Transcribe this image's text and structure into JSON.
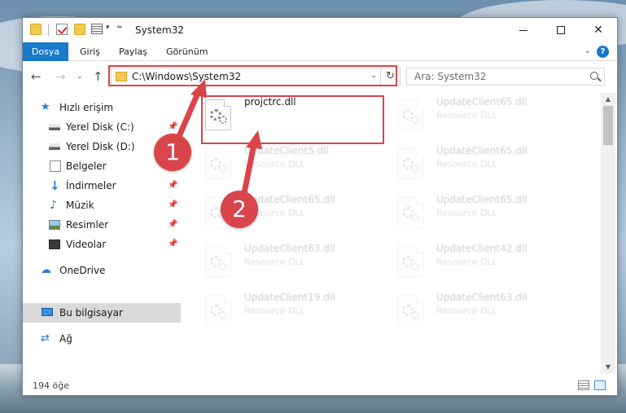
{
  "window": {
    "title": "System32",
    "minimize_icon": "minimize-icon",
    "maximize_icon": "maximize-icon",
    "close_label": "✕"
  },
  "ribbon": {
    "tabs": [
      {
        "label": "Dosya"
      },
      {
        "label": "Giriş"
      },
      {
        "label": "Paylaş"
      },
      {
        "label": "Görünüm"
      }
    ],
    "help_label": "?"
  },
  "navigation": {
    "address_path": "C:\\Windows\\System32",
    "search_placeholder": "Ara: System32"
  },
  "sidebar": {
    "items": [
      {
        "label": "Hızlı erişim",
        "icon": "star-icon"
      },
      {
        "label": "Yerel Disk (C:)",
        "icon": "drive-icon",
        "pinned": true
      },
      {
        "label": "Yerel Disk (D:)",
        "icon": "drive-icon"
      },
      {
        "label": "Belgeler",
        "icon": "documents-icon",
        "pinned": true
      },
      {
        "label": "İndirmeler",
        "icon": "download-icon",
        "pinned": true
      },
      {
        "label": "Müzik",
        "icon": "music-icon",
        "pinned": true
      },
      {
        "label": "Resimler",
        "icon": "pictures-icon",
        "pinned": true
      },
      {
        "label": "Videolar",
        "icon": "videos-icon",
        "pinned": true
      },
      {
        "label": "OneDrive",
        "icon": "cloud-icon"
      },
      {
        "label": "Bu bilgisayar",
        "icon": "computer-icon"
      },
      {
        "label": "Ağ",
        "icon": "network-icon"
      }
    ]
  },
  "files": [
    {
      "name": "projctrc.dll",
      "type": "",
      "faded": false
    },
    {
      "name": "UpdateClient65.dll",
      "type": "Resource DLL",
      "faded": true
    },
    {
      "name": "UpdateClient5.dll",
      "type": "Resource DLL",
      "faded": true
    },
    {
      "name": "UpdateClient65.dll",
      "type": "Resource DLL",
      "faded": true
    },
    {
      "name": "UpdateClient65.dll",
      "type": "Resource DLL",
      "faded": true
    },
    {
      "name": "UpdateClient65.dll",
      "type": "Resource DLL",
      "faded": true
    },
    {
      "name": "UpdateClient63.dll",
      "type": "Resource DLL",
      "faded": true
    },
    {
      "name": "UpdateClient42.dll",
      "type": "Resource DLL",
      "faded": true
    },
    {
      "name": "UpdateClient19.dll",
      "type": "Resource DLL",
      "faded": true
    },
    {
      "name": "UpdateClient63.dll",
      "type": "Resource DLL",
      "faded": true
    }
  ],
  "status": {
    "item_count": "194 öğe"
  },
  "callouts": [
    {
      "label": "1"
    },
    {
      "label": "2"
    }
  ],
  "colors": {
    "accent": "#1979ca",
    "callout": "#d9454a",
    "selection": "#cce8ff"
  }
}
